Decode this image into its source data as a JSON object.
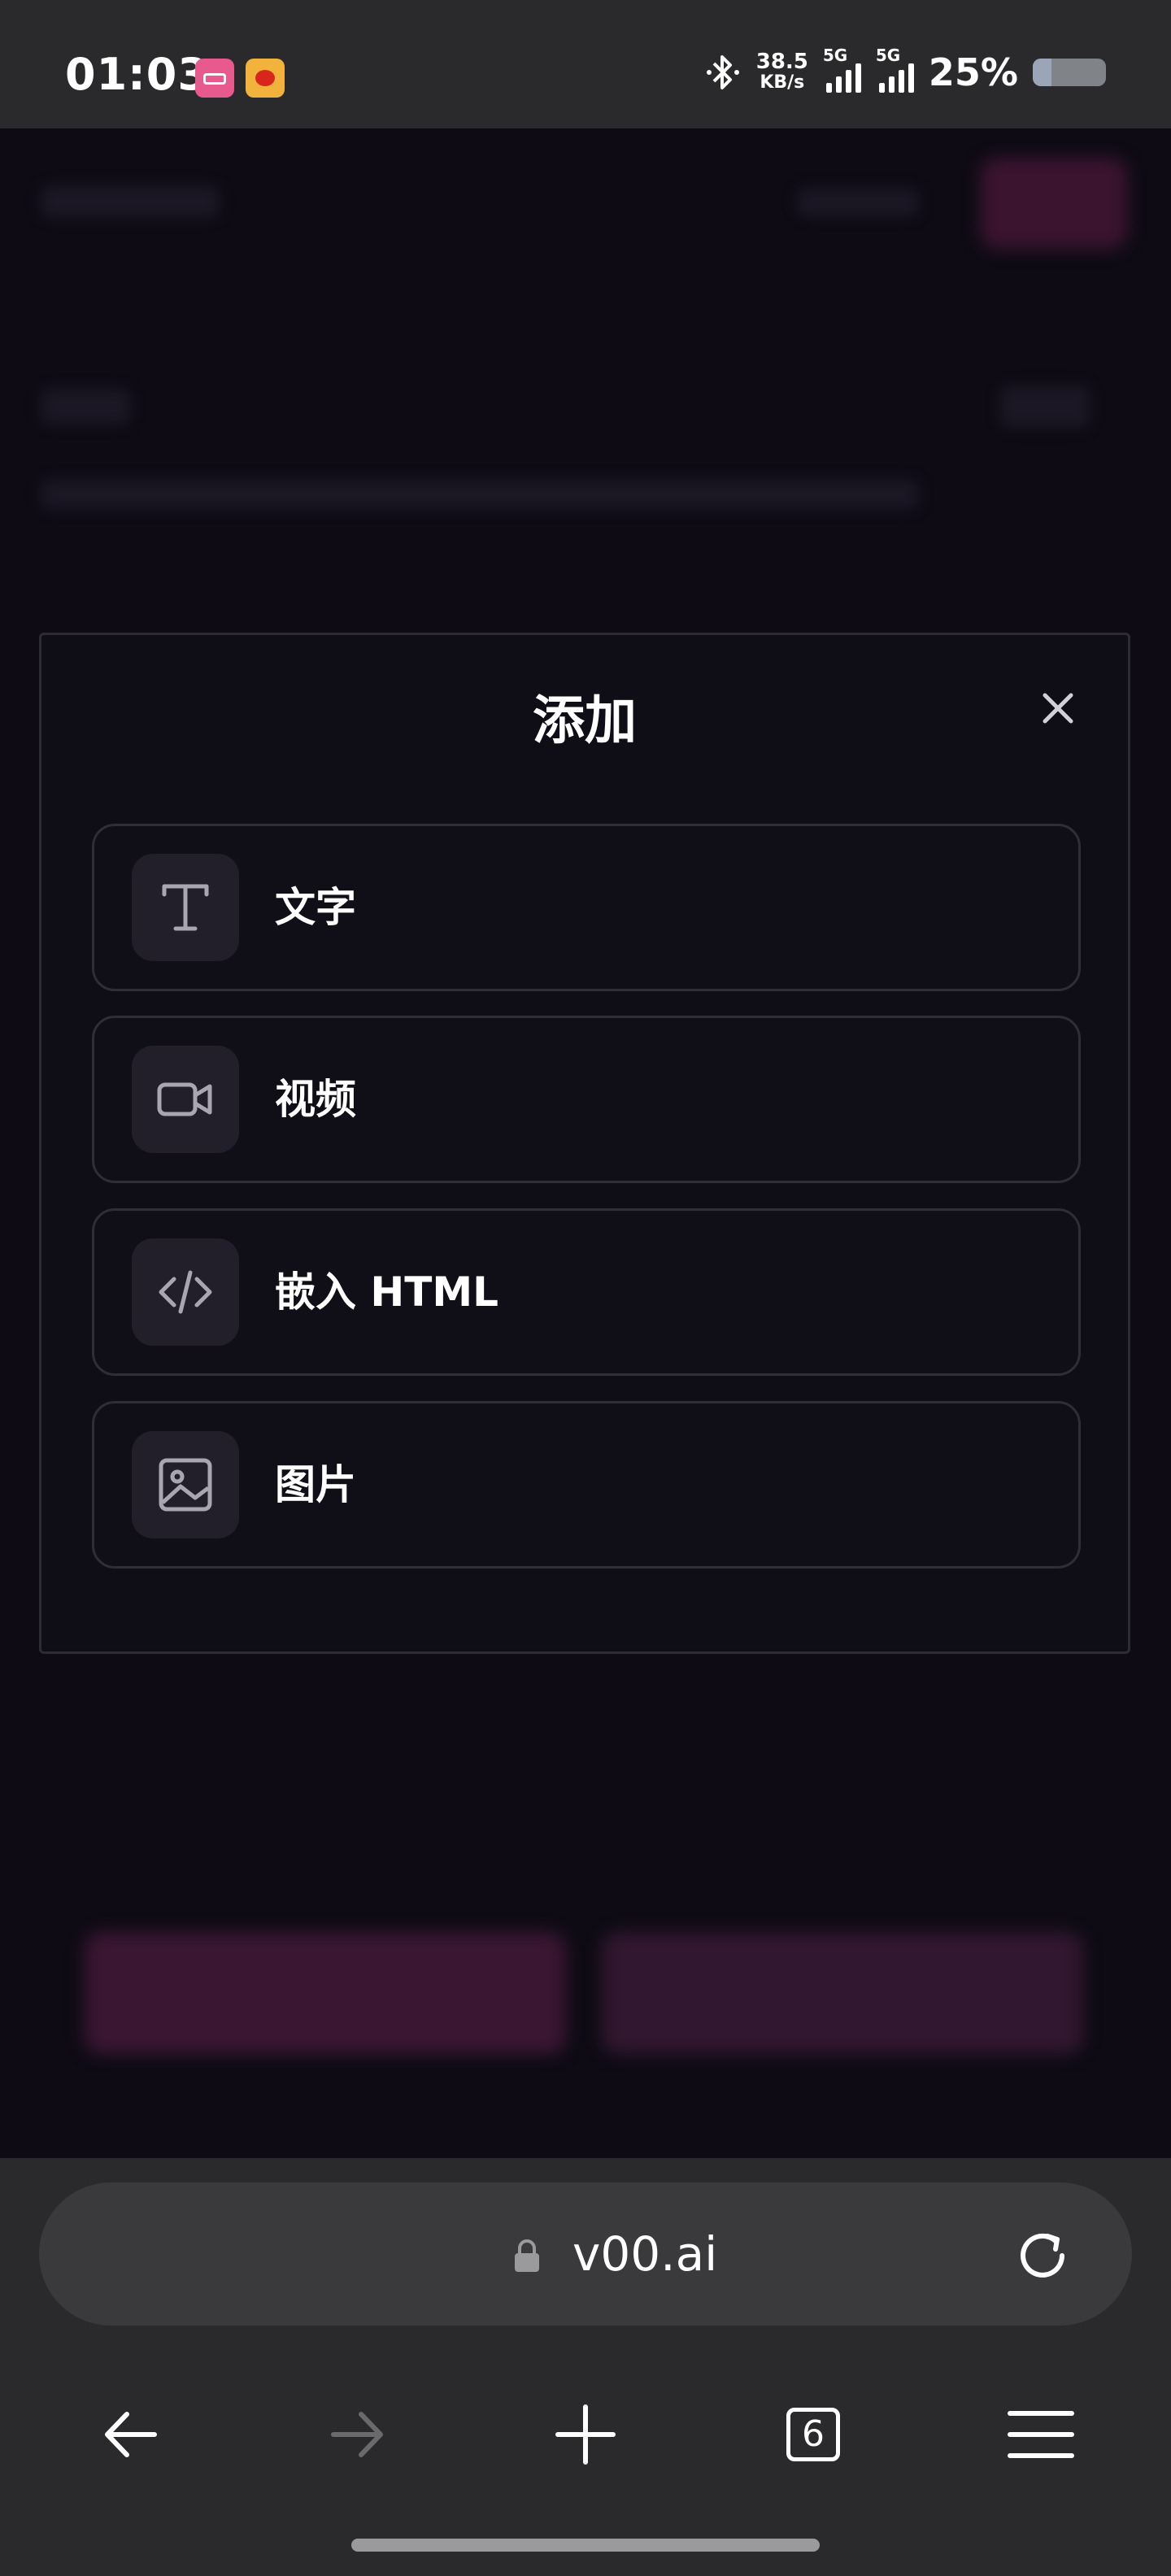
{
  "status_bar": {
    "time": "01:03",
    "speed_value": "38.5",
    "speed_unit": "KB/s",
    "sim1_label": "5G",
    "sim2_label": "5G",
    "battery": "25%",
    "battery_level": 0.25,
    "app_icons": [
      "bilibili-icon",
      "weibo-icon"
    ]
  },
  "modal": {
    "title": "添加",
    "options": [
      {
        "label": "文字",
        "icon": "text-icon"
      },
      {
        "label": "视频",
        "icon": "video-icon"
      },
      {
        "label": "嵌入 HTML",
        "icon": "code-icon"
      },
      {
        "label": "图片",
        "icon": "image-icon"
      }
    ]
  },
  "browser": {
    "url": "v00.ai",
    "tab_count": "6"
  },
  "colors": {
    "page_bg": "#0e0b15",
    "modal_bg": "#0f0d16",
    "option_border": "#302d39",
    "icon_tile": "#221f2b",
    "chrome_bg": "#2a2a2c",
    "accent_blurred": "#5a1f43"
  }
}
